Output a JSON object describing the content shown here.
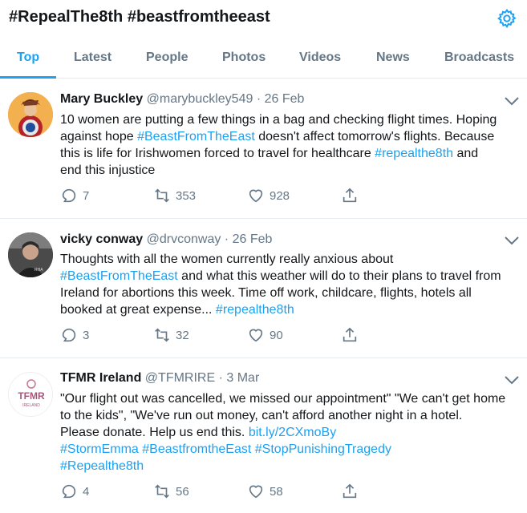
{
  "header": {
    "title": "#RepealThe8th #beastfromtheeast",
    "settings_icon": "gear-icon"
  },
  "tabs": [
    {
      "label": "Top",
      "active": true
    },
    {
      "label": "Latest"
    },
    {
      "label": "People"
    },
    {
      "label": "Photos"
    },
    {
      "label": "Videos"
    },
    {
      "label": "News"
    },
    {
      "label": "Broadcasts"
    }
  ],
  "tweets": [
    {
      "name": "Mary Buckley",
      "handle": "@marybuckley549",
      "separator": "·",
      "date": "26 Feb",
      "lines": [
        [
          {
            "t": "10 women are putting a few things in a bag and checking flight times. Hoping"
          }
        ],
        [
          {
            "t": "against hope "
          },
          {
            "t": "#BeastFromTheEast",
            "link": true
          },
          {
            "t": " doesn't affect tomorrow's flights. Because"
          }
        ],
        [
          {
            "t": "this is life for Irishwomen forced to travel for healthcare "
          },
          {
            "t": "#repealthe8th",
            "link": true
          },
          {
            "t": " and"
          }
        ],
        [
          {
            "t": "end this injustice"
          }
        ]
      ],
      "replies": "7",
      "retweets": "353",
      "likes": "928"
    },
    {
      "name": "vicky conway",
      "handle": "@drvconway",
      "separator": "·",
      "date": "26 Feb",
      "lines": [
        [
          {
            "t": "Thoughts with all the women currently really anxious about"
          }
        ],
        [
          {
            "t": "#BeastFromTheEast",
            "link": true
          },
          {
            "t": " and what this weather will do to their plans to travel from"
          }
        ],
        [
          {
            "t": "Ireland for abortions this week. Time off work, childcare, flights, hotels all"
          }
        ],
        [
          {
            "t": "booked at great expense... "
          },
          {
            "t": "#repealthe8th",
            "link": true
          }
        ]
      ],
      "replies": "3",
      "retweets": "32",
      "likes": "90"
    },
    {
      "name": "TFMR Ireland",
      "handle": "@TFMRIRE",
      "separator": "·",
      "date": "3 Mar",
      "avatar_text": "TFMR",
      "avatar_subtext": "IRELAND",
      "lines": [
        [
          {
            "t": "\"Our flight out was cancelled, we missed our appointment\" \"We can't get home"
          }
        ],
        [
          {
            "t": "to the kids\", \"We've run out money, can't afford another night in a hotel."
          }
        ],
        [
          {
            "t": "Please donate. Help us end this. "
          },
          {
            "t": "bit.ly/2CXmoBy",
            "link": true
          }
        ],
        [
          {
            "t": "#StormEmma",
            "link": true
          },
          {
            "t": " "
          },
          {
            "t": "#BeastfromtheEast",
            "link": true
          },
          {
            "t": "  "
          },
          {
            "t": "#StopPunishingTragedy",
            "link": true
          }
        ],
        [
          {
            "t": "#Repealthe8th",
            "link": true
          }
        ]
      ],
      "replies": "4",
      "retweets": "56",
      "likes": "58"
    }
  ],
  "colors": {
    "accent": "#1da1f2",
    "text": "#14171a",
    "muted": "#657786",
    "divider": "#e6ecf0"
  }
}
